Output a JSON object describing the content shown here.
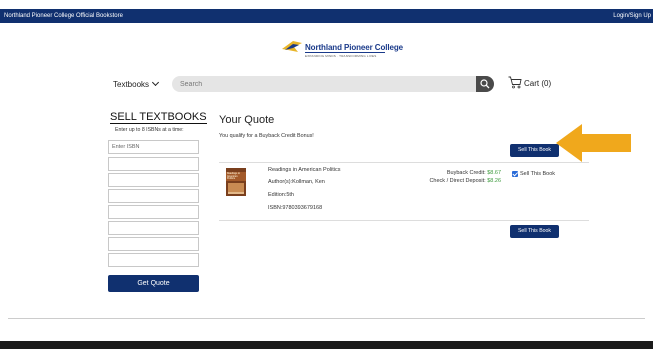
{
  "topbar": {
    "store_name": "Northland Pioneer College Official Bookstore",
    "login_label": "Login/Sign Up"
  },
  "logo": {
    "name": "Northland Pioneer College",
    "tagline": "EXPANDING MINDS · TRANSFORMING LIVES"
  },
  "nav": {
    "textbooks_label": "Textbooks",
    "search_placeholder": "Search",
    "cart_label": "Cart (0)"
  },
  "sell_panel": {
    "title": "SELL TEXTBOOKS",
    "subtitle": "Enter up to 8 ISBNs at a time:",
    "isbn_placeholder": "Enter ISBN",
    "get_quote_label": "Get Quote"
  },
  "quote": {
    "title": "Your Quote",
    "bonus_message": "You qualify for a Buyback Credit Bonus!",
    "sell_button_label": "Sell This Book",
    "items": [
      {
        "title": "Readings in American Politics",
        "authors": "Author(s):Kollman, Ken",
        "edition": "Edition:5th",
        "isbn": "ISBN:9780393679168",
        "buyback_credit_label": "Buyback Credit:",
        "buyback_credit_value": "$8.67",
        "deposit_label": "Check / Direct Deposit:",
        "deposit_value": "$8.26",
        "sell_checkbox_label": "Sell This Book",
        "sell_checked": true,
        "cover_text": "Readings in American Politics"
      }
    ]
  },
  "colors": {
    "brand_navy": "#10306f",
    "credit_green": "#3c9a3c",
    "arrow_orange": "#f0a81c"
  },
  "icons": {
    "search": "search-icon",
    "cart": "cart-icon",
    "chevron": "chevron-down-icon",
    "arrow": "arrow-left-icon"
  }
}
